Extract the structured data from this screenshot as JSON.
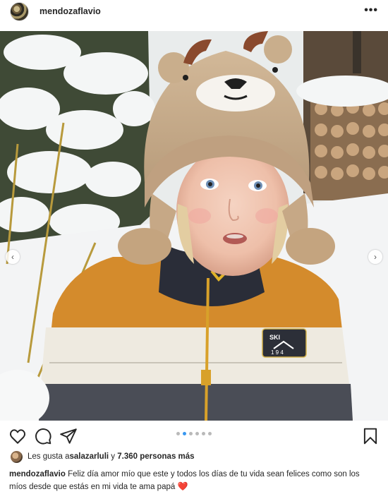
{
  "post": {
    "username": "mendozaflavio",
    "more_label": "•••"
  },
  "media": {
    "carousel_total": 6,
    "carousel_active_index": 1,
    "patch_text_1": "SKI",
    "patch_text_2": "1 9 4"
  },
  "actions": {
    "like_icon": "heart-icon",
    "comment_icon": "comment-icon",
    "share_icon": "send-icon",
    "save_icon": "bookmark-icon"
  },
  "likes": {
    "prefix": "Les gusta a ",
    "user": "salazarluli",
    "middle": " y ",
    "count": "7.360 personas más"
  },
  "caption": {
    "username": "mendozaflavio",
    "text": "Feliz día amor mío que este y todos los días de tu vida sean felices como son los míos desde que estás en mi vida te ama papá",
    "emoji": "❤️"
  },
  "colors": {
    "accent_dot": "#3897f0",
    "text": "#262626",
    "heart_emoji": "#e0245e"
  }
}
